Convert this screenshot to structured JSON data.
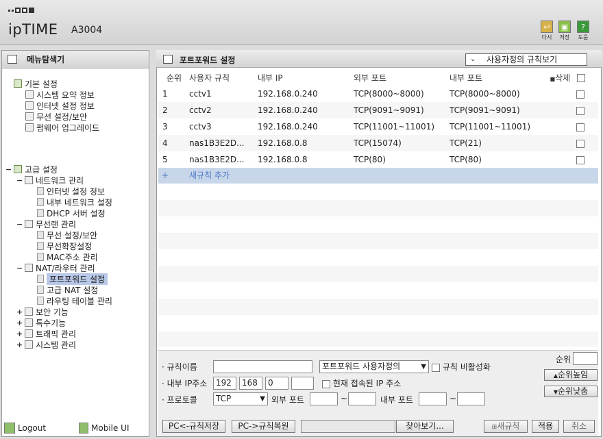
{
  "header": {
    "brand": "ipTIME",
    "model": "A3004",
    "buttons": [
      {
        "label": "다시",
        "icon": "undo-icon",
        "color": "#d6b24a"
      },
      {
        "label": "저장",
        "icon": "save-icon",
        "color": "#8ac04a"
      },
      {
        "label": "도움",
        "icon": "help-icon",
        "color": "#3a9a3a"
      }
    ]
  },
  "sidebar": {
    "title": "메뉴탐색기",
    "basic": {
      "label": "기본 설정",
      "items": [
        "시스템 요약 정보",
        "인터넷 설정 정보",
        "무선 설정/보안",
        "펌웨어 업그레이드"
      ]
    },
    "advanced": {
      "label": "고급 설정",
      "network": {
        "label": "네트워크 관리",
        "items": [
          "인터넷 설정 정보",
          "내부 네트워크 설정",
          "DHCP 서버 설정"
        ]
      },
      "wireless": {
        "label": "무선랜 관리",
        "items": [
          "무선 설정/보안",
          "무선확장설정",
          "MAC주소 관리"
        ]
      },
      "nat": {
        "label": "NAT/라우터 관리",
        "items": [
          "포트포워드 설정",
          "고급 NAT 설정",
          "라우팅 테이블 관리"
        ]
      },
      "security": "보안 기능",
      "special": "특수기능",
      "traffic": "트래픽 관리",
      "system": "시스템 관리"
    },
    "logout": "Logout",
    "mobile": "Mobile UI"
  },
  "main": {
    "title": "포트포워드 설정",
    "view_select": "사용자정의 규칙보기",
    "columns": {
      "order": "순위",
      "rule": "사용자 규칙",
      "inner_ip": "내부 IP",
      "ext_port": "외부 포트",
      "int_port": "내부 포트",
      "delete": "삭제"
    },
    "rows": [
      {
        "order": "1",
        "rule": "cctv1",
        "ip": "192.168.0.240",
        "ext": "TCP(8000~8000)",
        "int": "TCP(8000~8000)"
      },
      {
        "order": "2",
        "rule": "cctv2",
        "ip": "192.168.0.240",
        "ext": "TCP(9091~9091)",
        "int": "TCP(9091~9091)"
      },
      {
        "order": "3",
        "rule": "cctv3",
        "ip": "192.168.0.240",
        "ext": "TCP(11001~11001)",
        "int": "TCP(11001~11001)"
      },
      {
        "order": "4",
        "rule": "nas1B3E2D...",
        "ip": "192.168.0.8",
        "ext": "TCP(15074)",
        "int": "TCP(21)"
      },
      {
        "order": "5",
        "rule": "nas1B3E2D...",
        "ip": "192.168.0.8",
        "ext": "TCP(80)",
        "int": "TCP(80)"
      }
    ],
    "add_rule": "새규칙 추가"
  },
  "form": {
    "rule_name_label": "규칙이름",
    "rule_type": "포트포워드 사용자정의",
    "disable_label": "규칙 비활성화",
    "ip_label": "내부 IP주소",
    "ip": [
      "192",
      "168",
      "0",
      ""
    ],
    "current_ip_label": "현재 접속된 IP 주소",
    "protocol_label": "프로토콜",
    "protocol": "TCP",
    "ext_port_label": "외부 포트",
    "int_port_label": "내부 포트",
    "tilde": "~",
    "order_label": "순위",
    "order_up": "순위높임",
    "order_down": "순위낮춤",
    "pc_save": "PC<-규칙저장",
    "pc_restore": "PC->규칙복원",
    "browse": "찾아보기...",
    "new_rule": "새규칙",
    "apply": "적용",
    "cancel": "취소"
  }
}
